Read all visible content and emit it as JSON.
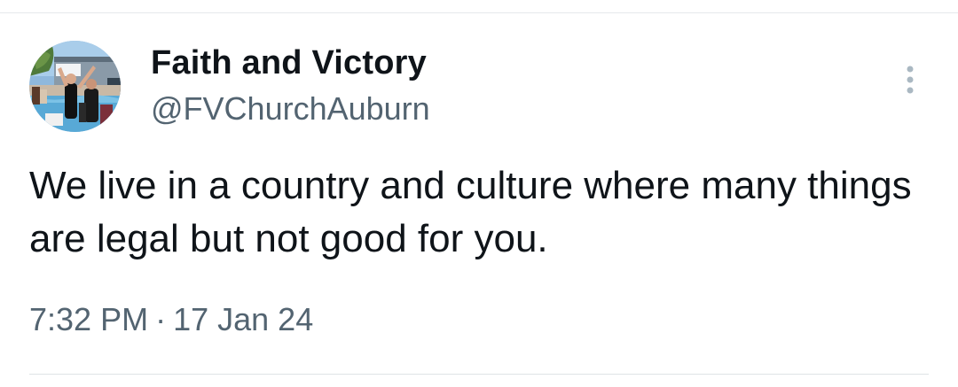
{
  "author": {
    "display_name": "Faith and Victory",
    "handle": "@FVChurchAuburn",
    "avatar_icon": "profile-photo-baptism"
  },
  "more_icon": "more-vertical-icon",
  "tweet": {
    "text": "We live in a country and culture where many things are legal but not good for you.",
    "time": "7:32 PM",
    "separator": "·",
    "date": "17 Jan 24"
  },
  "colors": {
    "primary_text": "#0f1419",
    "secondary_text": "#536471",
    "more_icon": "#aab8c2",
    "divider": "#dfe3e6"
  }
}
